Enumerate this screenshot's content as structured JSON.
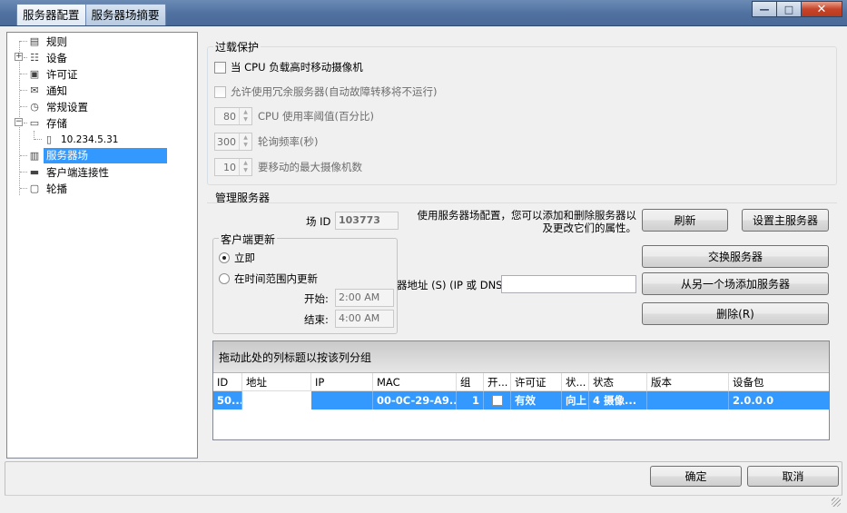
{
  "tabs": [
    "服务器配置",
    "服务器场摘要"
  ],
  "window_buttons": {
    "minimize": "—",
    "maximize": "□",
    "close": "✕"
  },
  "tree": [
    {
      "label": "规则",
      "icon": "rules-icon"
    },
    {
      "label": "设备",
      "icon": "devices-icon"
    },
    {
      "label": "许可证",
      "icon": "license-icon"
    },
    {
      "label": "通知",
      "icon": "mail-icon"
    },
    {
      "label": "常规设置",
      "icon": "settings-icon"
    },
    {
      "label": "存储",
      "icon": "storage-icon"
    },
    {
      "label": "10.234.5.31",
      "icon": "disk-icon"
    },
    {
      "label": "服务器场",
      "icon": "server-farm-icon"
    },
    {
      "label": "客户端连接性",
      "icon": "client-icon"
    },
    {
      "label": "轮播",
      "icon": "monitor-icon"
    }
  ],
  "overload": {
    "title": "过载保护",
    "move_cameras_label": "当 CPU 负载高时移动摄像机",
    "allow_redundant_label": "允许使用冗余服务器(自动故障转移将不运行)",
    "cpu_threshold": {
      "value": "80",
      "label": "CPU 使用率阈值(百分比)"
    },
    "poll_freq": {
      "value": "300",
      "label": "轮询频率(秒)"
    },
    "max_cameras": {
      "value": "10",
      "label": "要移动的最大摄像机数"
    }
  },
  "manage": {
    "title": "管理服务器",
    "farm_id_label": "场 ID",
    "farm_id_value": "103773",
    "description_line1": "使用服务器场配置，您可以添加和删除服务器以",
    "description_line2": "及更改它们的属性。",
    "refresh_button": "刷新",
    "set_master_button": "设置主服务器",
    "swap_button": "交换服务器",
    "add_from_farm_button": "从另一个场添加服务器",
    "delete_button": "删除(R)",
    "address_label": "器地址 (S) (IP 或 DNS)",
    "address_value": "",
    "client_update": {
      "title": "客户端更新",
      "option_now": "立即",
      "option_range": "在时间范围内更新",
      "start_label": "开始:",
      "start_value": "2:00 AM",
      "end_label": "结束:",
      "end_value": "4:00 AM"
    }
  },
  "grid": {
    "group_hint": "拖动此处的列标题以按该列分组",
    "columns": [
      "ID",
      "地址",
      "IP",
      "MAC",
      "组",
      "开...",
      "许可证",
      "状...",
      "状态",
      "版本",
      "设备包"
    ],
    "rows": [
      {
        "id": "50...",
        "address": "",
        "ip": "",
        "mac": "00-0C-29-A9...",
        "group": "1",
        "license": "有效",
        "state_short": "向上",
        "status": "4 摄像...",
        "version": "",
        "package": "2.0.0.0"
      }
    ]
  },
  "footer": {
    "ok": "确定",
    "cancel": "取消"
  }
}
